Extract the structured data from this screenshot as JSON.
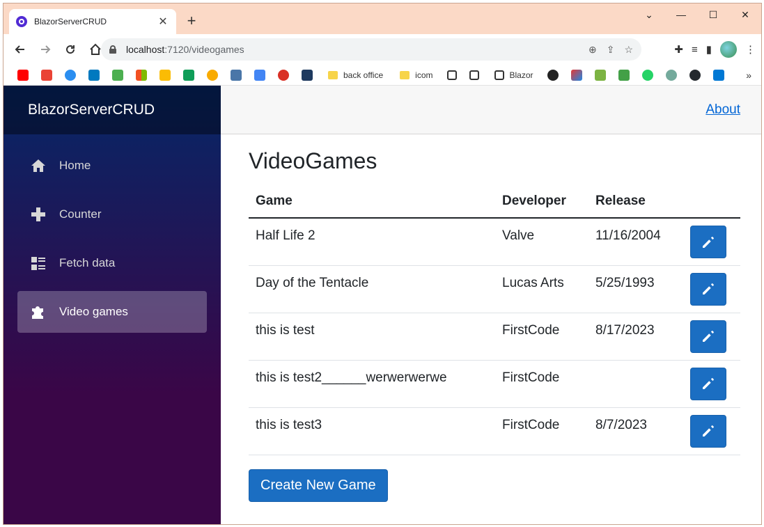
{
  "browser": {
    "tab_title": "BlazorServerCRUD",
    "url_host": "localhost",
    "url_path": ":7120/videogames",
    "window_controls": [
      "⌄",
      "—",
      "☐",
      "✕"
    ],
    "bookmarks": {
      "folder_1": "back office",
      "folder_2": "icom",
      "item_blazor": "Blazor"
    }
  },
  "app": {
    "brand": "BlazorServerCRUD",
    "nav": [
      {
        "label": "Home",
        "icon": "home-icon"
      },
      {
        "label": "Counter",
        "icon": "plus-icon"
      },
      {
        "label": "Fetch data",
        "icon": "list-rich-icon"
      },
      {
        "label": "Video games",
        "icon": "puzzle-icon",
        "active": true
      }
    ],
    "top_link": "About"
  },
  "page": {
    "title": "VideoGames",
    "columns": [
      "Game",
      "Developer",
      "Release"
    ],
    "rows": [
      {
        "game": "Half Life 2",
        "developer": "Valve",
        "release": "11/16/2004"
      },
      {
        "game": "Day of the Tentacle",
        "developer": "Lucas Arts",
        "release": "5/25/1993"
      },
      {
        "game": "this is test",
        "developer": "FirstCode",
        "release": "8/17/2023"
      },
      {
        "game": "this is test2______werwerwerwe",
        "developer": "FirstCode",
        "release": ""
      },
      {
        "game": "this is test3",
        "developer": "FirstCode",
        "release": "8/7/2023"
      }
    ],
    "create_button": "Create New Game"
  },
  "colors": {
    "primary": "#1b6ec2",
    "sidebar_top": "#052767",
    "sidebar_bottom": "#3a0647",
    "link": "#0366d6"
  }
}
